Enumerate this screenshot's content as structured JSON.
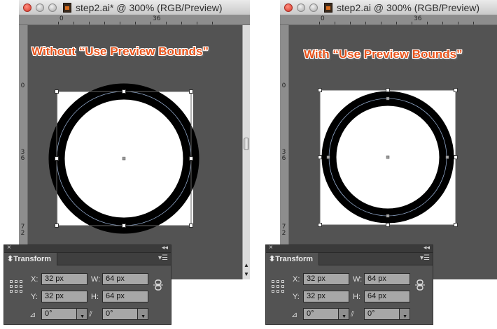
{
  "windows": [
    {
      "id": "left",
      "title": "step2.ai* @ 300% (RGB/Preview)",
      "caption": "Without “Use Preview Bounds”",
      "ruler_top": [
        "0",
        "36"
      ],
      "ruler_left": [
        "0",
        "36",
        "72"
      ],
      "handles_on_outer_edge": false
    },
    {
      "id": "right",
      "title": "step2.ai @ 300% (RGB/Preview)",
      "caption": "With “Use Preview Bounds”",
      "ruler_top": [
        "0",
        "36"
      ],
      "ruler_left": [
        "0",
        "36",
        "72"
      ],
      "handles_on_outer_edge": true
    }
  ],
  "panels": [
    {
      "id": "left",
      "tab_label": "Transform",
      "x_label": "X:",
      "x_value": "32 px",
      "y_label": "Y:",
      "y_value": "32 px",
      "w_label": "W:",
      "w_value": "64 px",
      "h_label": "H:",
      "h_value": "64 px",
      "rotate_value": "0°",
      "shear_value": "0°"
    },
    {
      "id": "right",
      "tab_label": "Transform",
      "x_label": "X:",
      "x_value": "32 px",
      "y_label": "Y:",
      "y_value": "32 px",
      "w_label": "W:",
      "w_value": "64 px",
      "h_label": "H:",
      "h_value": "64 px",
      "rotate_value": "0°",
      "shear_value": "0°"
    }
  ],
  "colors": {
    "canvas": "#535353",
    "caption": "#e8541c",
    "ring": "#000000",
    "artboard": "#ffffff"
  },
  "icons": {
    "close": "close-icon",
    "collapse": "double-chevron-icon",
    "panel_menu": "panel-menu-icon",
    "reference_point": "reference-point-icon",
    "constrain": "link-icon",
    "rotate": "rotate-icon",
    "shear": "shear-icon"
  }
}
